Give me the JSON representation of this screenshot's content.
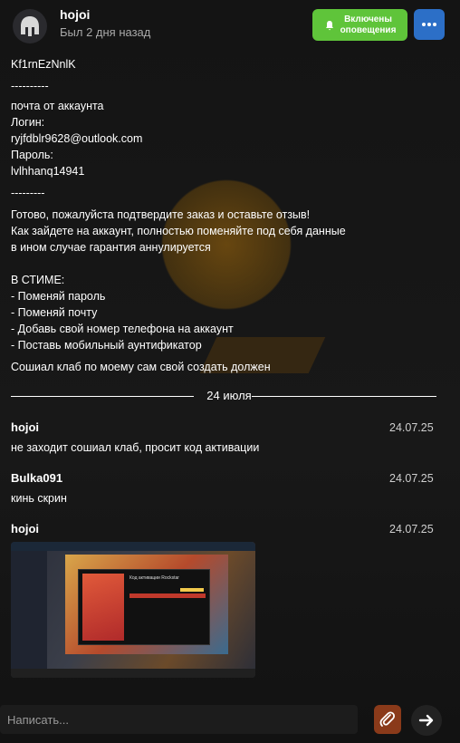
{
  "header": {
    "username": "hojoi",
    "status": "Был 2 дня назад",
    "notifications_label": "Включены\nоповещения",
    "colors": {
      "notify": "#5fc43a",
      "more": "#2c6fc7"
    }
  },
  "message": {
    "lines": [
      "Kf1rnEzNnlK",
      "----------",
      "почта от аккаунта",
      "Логин:",
      "ryjfdblr9628@outlook.com",
      "Пароль:",
      "lvlhhanq14941",
      "---------",
      "Готово, пожалуйста подтвердите заказ и оставьте отзыв!",
      "Как зайдете на аккаунт, полностью поменяйте под себя данные",
      "в ином случае гарантия аннулируется",
      "",
      "В СТИМЕ:",
      "- Поменяй пароль",
      "- Поменяй почту",
      "- Добавь свой номер телефона на аккаунт",
      "- Поставь мобильный аунтификатор"
    ],
    "last_line": "Сошиал клаб по моему сам свой создать должен"
  },
  "divider_label": "24 июля",
  "posts": [
    {
      "author": "hojoi",
      "date": "24.07.25",
      "text": "не заходит сошиал клаб, просит код активации"
    },
    {
      "author": "Bulka091",
      "date": "24.07.25",
      "text": "кинь скрин"
    },
    {
      "author": "hojoi",
      "date": "24.07.25",
      "text": ""
    }
  ],
  "screenshot": {
    "dialog_title": "Код активации Rockstar"
  },
  "composer": {
    "placeholder": "Написать..."
  },
  "icons": [
    "avatar-helmet-icon",
    "bell-icon",
    "more-dots-icon",
    "paperclip-icon",
    "arrow-right-icon"
  ]
}
